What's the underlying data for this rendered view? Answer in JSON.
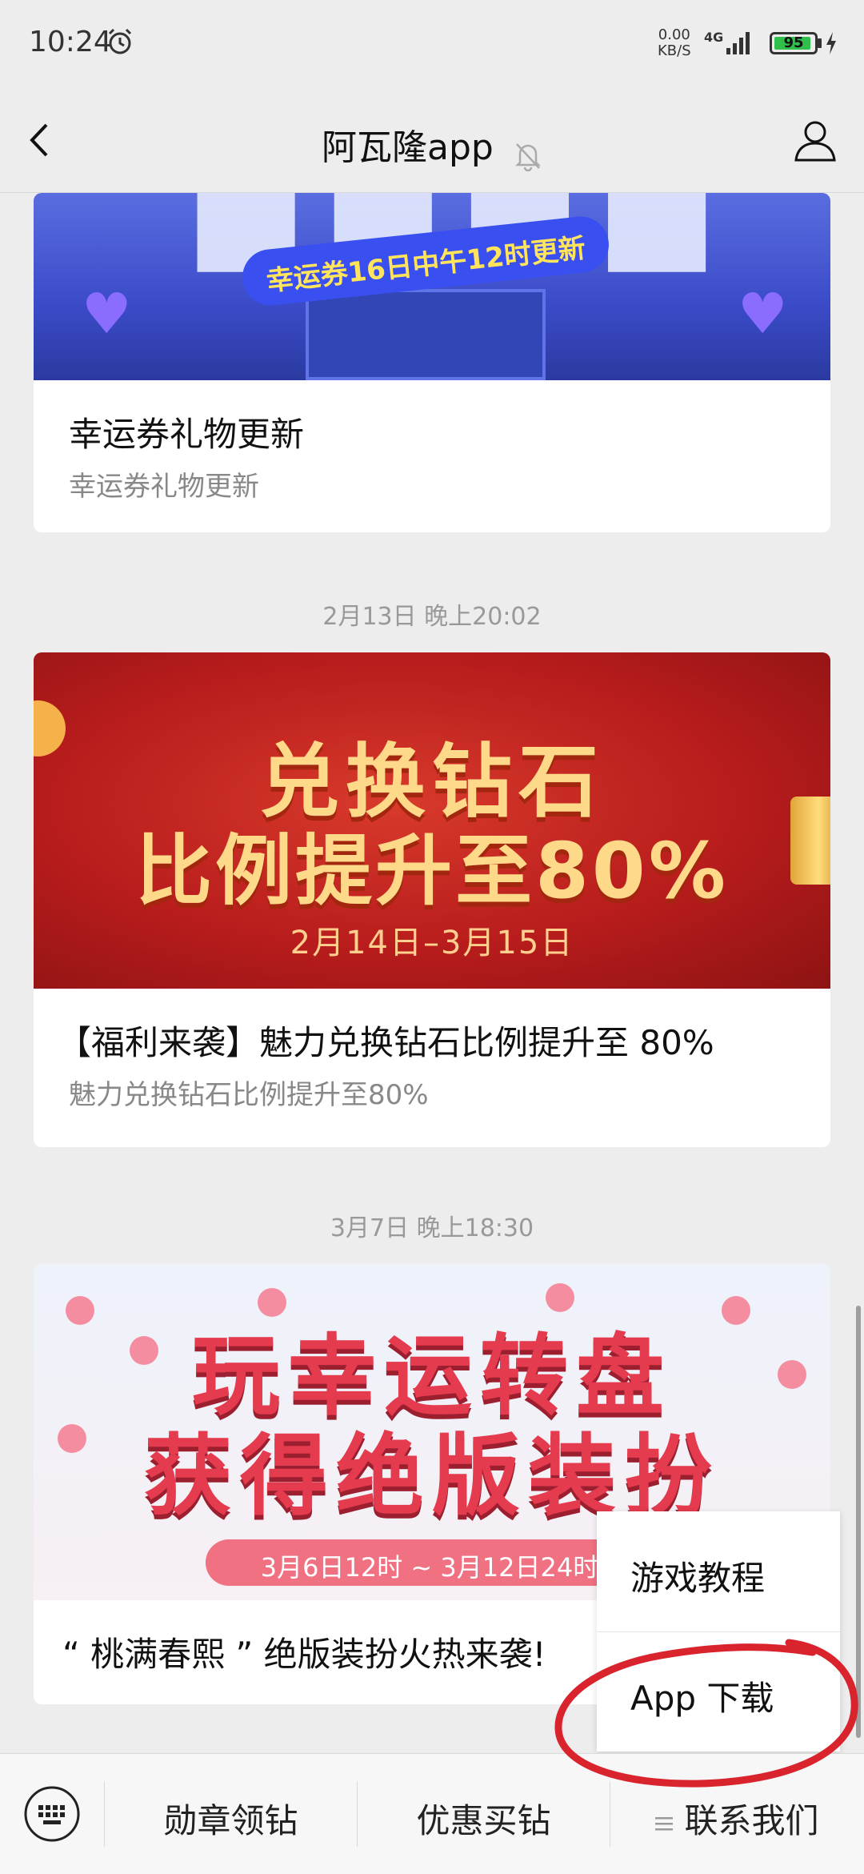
{
  "status_bar": {
    "time": "10:24",
    "net_speed_value": "0.00",
    "net_speed_unit": "KB/S",
    "network_type": "4G",
    "battery_level": "95"
  },
  "header": {
    "title": "阿瓦隆app"
  },
  "feed": [
    {
      "banner_ribbon_text": "幸运券16日中午12时更新",
      "title": "幸运券礼物更新",
      "subtitle": "幸运券礼物更新"
    },
    {
      "timestamp": "2月13日 晚上20:02",
      "banner_line1": "兑换钻石",
      "banner_line2": "比例提升至80%",
      "banner_date": "2月14日–3月15日",
      "title": "【福利来袭】魅力兑换钻石比例提升至 80%",
      "subtitle": "魅力兑换钻石比例提升至80%"
    },
    {
      "timestamp": "3月7日 晚上18:30",
      "banner_line1": "玩幸运转盘",
      "banner_line2": "获得绝版装扮",
      "banner_date": "3月6日12时 ~ 3月12日24时",
      "title": "“ 桃满春熙 ” 绝版装扮火热来袭!"
    }
  ],
  "popup_menu": {
    "items": [
      "游戏教程",
      "App 下载"
    ]
  },
  "bottom_bar": {
    "items": [
      "勋章领钻",
      "优惠买钻",
      "联系我们"
    ]
  },
  "colors": {
    "annotation": "#d9232d",
    "battery_fill": "#2fbf4a"
  }
}
